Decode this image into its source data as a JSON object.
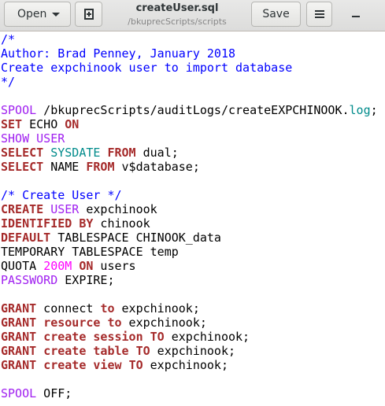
{
  "header": {
    "open_label": "Open",
    "title": "createUser.sql",
    "subtitle": "/bkuprecScripts/scripts",
    "save_label": "Save",
    "icons": {
      "open_dropdown": "chevron-down-icon",
      "new_tab": "new-document-icon",
      "menu": "hamburger-menu-icon",
      "minimize": "minimize-icon"
    }
  },
  "editor": {
    "lines": [
      [
        {
          "t": "/*",
          "c": "cm"
        }
      ],
      [
        {
          "t": "Author: Brad Penney, January 2018",
          "c": "cm"
        }
      ],
      [
        {
          "t": "Create expchinook user to import database",
          "c": "cm"
        }
      ],
      [
        {
          "t": "*/",
          "c": "cm"
        }
      ],
      [],
      [
        {
          "t": "SPOOL",
          "c": "mg"
        },
        {
          "t": " /bkuprecScripts/auditLogs/createEXPCHINOOK."
        },
        {
          "t": "log",
          "c": "tl"
        },
        {
          "t": ";"
        }
      ],
      [
        {
          "t": "SET",
          "c": "kw"
        },
        {
          "t": " ECHO "
        },
        {
          "t": "ON",
          "c": "kw"
        }
      ],
      [
        {
          "t": "SHOW",
          "c": "mg"
        },
        {
          "t": " "
        },
        {
          "t": "USER",
          "c": "mg"
        }
      ],
      [
        {
          "t": "SELECT",
          "c": "kw"
        },
        {
          "t": " "
        },
        {
          "t": "SYSDATE",
          "c": "tl"
        },
        {
          "t": " "
        },
        {
          "t": "FROM",
          "c": "kw"
        },
        {
          "t": " dual;"
        }
      ],
      [
        {
          "t": "SELECT",
          "c": "kw"
        },
        {
          "t": " NAME "
        },
        {
          "t": "FROM",
          "c": "kw"
        },
        {
          "t": " v$database;"
        }
      ],
      [],
      [
        {
          "t": "/* Create User */",
          "c": "cm"
        }
      ],
      [
        {
          "t": "CREATE",
          "c": "kw"
        },
        {
          "t": " "
        },
        {
          "t": "USER",
          "c": "mg"
        },
        {
          "t": " expchinook"
        }
      ],
      [
        {
          "t": "IDENTIFIED BY",
          "c": "kw"
        },
        {
          "t": " chinook"
        }
      ],
      [
        {
          "t": "DEFAULT",
          "c": "kw"
        },
        {
          "t": " TABLESPACE CHINOOK_data"
        }
      ],
      [
        {
          "t": "TEMPORARY TABLESPACE temp"
        }
      ],
      [
        {
          "t": "QUOTA "
        },
        {
          "t": "200M",
          "c": "num"
        },
        {
          "t": " "
        },
        {
          "t": "ON",
          "c": "kw"
        },
        {
          "t": " users"
        }
      ],
      [
        {
          "t": "PASSWORD",
          "c": "mg"
        },
        {
          "t": " EXPIRE;"
        }
      ],
      [],
      [
        {
          "t": "GRANT",
          "c": "kw"
        },
        {
          "t": " connect "
        },
        {
          "t": "to",
          "c": "kw"
        },
        {
          "t": " expchinook;"
        }
      ],
      [
        {
          "t": "GRANT",
          "c": "kw"
        },
        {
          "t": " "
        },
        {
          "t": "resource",
          "c": "kw"
        },
        {
          "t": " "
        },
        {
          "t": "to",
          "c": "kw"
        },
        {
          "t": " expchinook;"
        }
      ],
      [
        {
          "t": "GRANT",
          "c": "kw"
        },
        {
          "t": " "
        },
        {
          "t": "create",
          "c": "kw"
        },
        {
          "t": " "
        },
        {
          "t": "session",
          "c": "kw"
        },
        {
          "t": " "
        },
        {
          "t": "TO",
          "c": "kw"
        },
        {
          "t": " expchinook;"
        }
      ],
      [
        {
          "t": "GRANT",
          "c": "kw"
        },
        {
          "t": " "
        },
        {
          "t": "create",
          "c": "kw"
        },
        {
          "t": " "
        },
        {
          "t": "table",
          "c": "kw"
        },
        {
          "t": " "
        },
        {
          "t": "TO",
          "c": "kw"
        },
        {
          "t": " expchinook;"
        }
      ],
      [
        {
          "t": "GRANT",
          "c": "kw"
        },
        {
          "t": " "
        },
        {
          "t": "create",
          "c": "kw"
        },
        {
          "t": " "
        },
        {
          "t": "view",
          "c": "kw"
        },
        {
          "t": " "
        },
        {
          "t": "TO",
          "c": "kw"
        },
        {
          "t": " expchinook;"
        }
      ],
      [],
      [
        {
          "t": "SPOOL",
          "c": "mg"
        },
        {
          "t": " OFF;"
        }
      ]
    ]
  }
}
